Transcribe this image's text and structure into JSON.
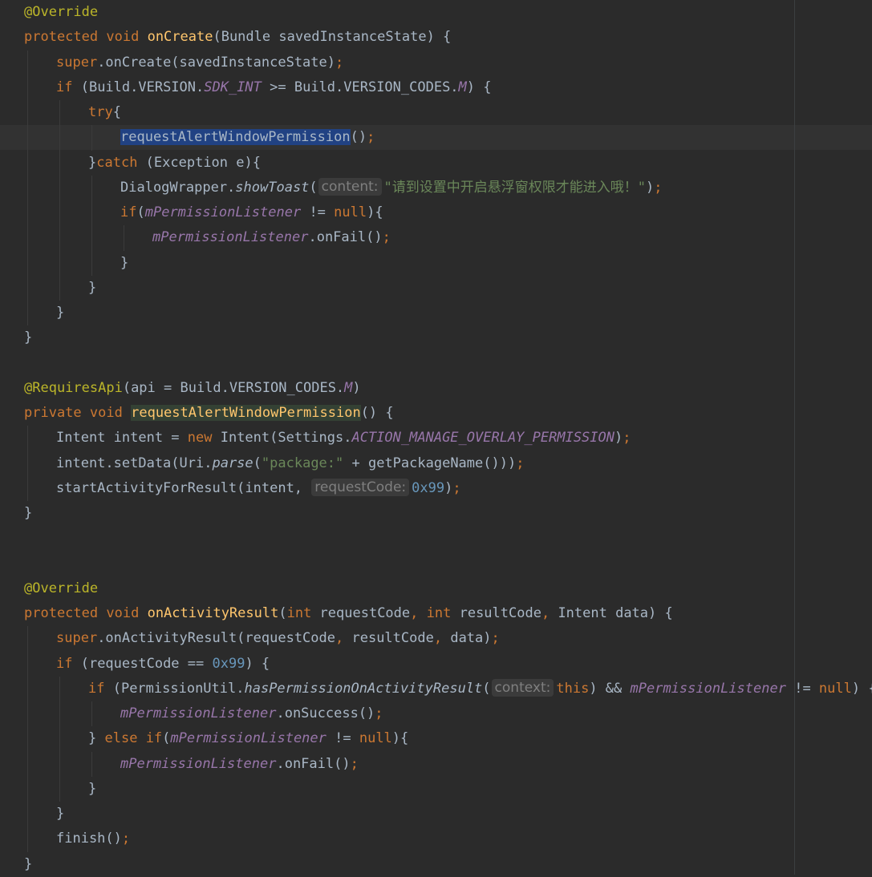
{
  "colors": {
    "background": "#2b2b2b",
    "keyword": "#cc7832",
    "annotation": "#bbb529",
    "method_declaration": "#ffc66d",
    "plain": "#a9b7c6",
    "field": "#9876aa",
    "number": "#6897bb",
    "string": "#6a8759",
    "inlay_hint": "#7f7f7f",
    "selection": "#214283"
  },
  "code": {
    "lines": [
      {
        "indent": 0,
        "tokens": [
          {
            "t": "@Override",
            "k": "ann"
          }
        ]
      },
      {
        "indent": 0,
        "tokens": [
          {
            "t": "protected",
            "k": "kw"
          },
          {
            "t": " "
          },
          {
            "t": "void",
            "k": "kw"
          },
          {
            "t": " "
          },
          {
            "t": "onCreate",
            "k": "fn"
          },
          {
            "t": "(Bundle savedInstanceState) {"
          }
        ]
      },
      {
        "indent": 1,
        "tokens": [
          {
            "t": "super",
            "k": "kw"
          },
          {
            "t": ".onCreate(savedInstanceState)"
          },
          {
            "t": ";",
            "k": "kw"
          }
        ]
      },
      {
        "indent": 1,
        "tokens": [
          {
            "t": "if",
            "k": "kw"
          },
          {
            "t": " (Build.VERSION."
          },
          {
            "t": "SDK_INT",
            "k": "static"
          },
          {
            "t": " >= Build.VERSION_CODES."
          },
          {
            "t": "M",
            "k": "static"
          },
          {
            "t": ") {"
          }
        ]
      },
      {
        "indent": 2,
        "tokens": [
          {
            "t": "try",
            "k": "kw"
          },
          {
            "t": "{"
          }
        ]
      },
      {
        "indent": 3,
        "caret": true,
        "tokens": [
          {
            "t": "requestAlertWindowPermission",
            "k": "sel"
          },
          {
            "t": "()"
          },
          {
            "t": ";",
            "k": "kw"
          }
        ]
      },
      {
        "indent": 2,
        "tokens": [
          {
            "t": "}"
          },
          {
            "t": "catch",
            "k": "kw"
          },
          {
            "t": " (Exception e){"
          }
        ]
      },
      {
        "indent": 3,
        "tokens": [
          {
            "t": "DialogWrapper."
          },
          {
            "t": "showToast",
            "k": "call"
          },
          {
            "t": "("
          },
          {
            "t": "content:",
            "k": "hint"
          },
          {
            "t": "\"请到设置中开启悬浮窗权限才能进入哦！\"",
            "k": "str"
          },
          {
            "t": ")"
          },
          {
            "t": ";",
            "k": "kw"
          }
        ]
      },
      {
        "indent": 3,
        "tokens": [
          {
            "t": "if",
            "k": "kw"
          },
          {
            "t": "("
          },
          {
            "t": "mPermissionListener",
            "k": "field"
          },
          {
            "t": " != "
          },
          {
            "t": "null",
            "k": "kw"
          },
          {
            "t": "){"
          }
        ]
      },
      {
        "indent": 4,
        "tokens": [
          {
            "t": "mPermissionListener",
            "k": "field"
          },
          {
            "t": ".onFail()"
          },
          {
            "t": ";",
            "k": "kw"
          }
        ]
      },
      {
        "indent": 3,
        "tokens": [
          {
            "t": "}"
          }
        ]
      },
      {
        "indent": 2,
        "tokens": [
          {
            "t": "}"
          }
        ]
      },
      {
        "indent": 1,
        "tokens": [
          {
            "t": "}"
          }
        ]
      },
      {
        "indent": 0,
        "tokens": [
          {
            "t": "}"
          }
        ]
      },
      {
        "indent": 0,
        "tokens": []
      },
      {
        "indent": 0,
        "tokens": [
          {
            "t": "@RequiresApi",
            "k": "ann"
          },
          {
            "t": "(api = Build.VERSION_CODES."
          },
          {
            "t": "M",
            "k": "static"
          },
          {
            "t": ")"
          }
        ]
      },
      {
        "indent": 0,
        "tokens": [
          {
            "t": "private",
            "k": "kw"
          },
          {
            "t": " "
          },
          {
            "t": "void",
            "k": "kw"
          },
          {
            "t": " "
          },
          {
            "t": "requestAlertWindowPermission",
            "k": "fnu"
          },
          {
            "t": "() {"
          }
        ]
      },
      {
        "indent": 1,
        "tokens": [
          {
            "t": "Intent intent = "
          },
          {
            "t": "new",
            "k": "kw"
          },
          {
            "t": " Intent(Settings."
          },
          {
            "t": "ACTION_MANAGE_OVERLAY_PERMISSION",
            "k": "static"
          },
          {
            "t": ")"
          },
          {
            "t": ";",
            "k": "kw"
          }
        ]
      },
      {
        "indent": 1,
        "tokens": [
          {
            "t": "intent.setData(Uri."
          },
          {
            "t": "parse",
            "k": "call"
          },
          {
            "t": "("
          },
          {
            "t": "\"package:\"",
            "k": "str"
          },
          {
            "t": " + getPackageName()))"
          },
          {
            "t": ";",
            "k": "kw"
          }
        ]
      },
      {
        "indent": 1,
        "tokens": [
          {
            "t": "startActivityForResult(intent, "
          },
          {
            "t": "requestCode:",
            "k": "hint"
          },
          {
            "t": "0x99",
            "k": "num"
          },
          {
            "t": ")"
          },
          {
            "t": ";",
            "k": "kw"
          }
        ]
      },
      {
        "indent": 0,
        "tokens": [
          {
            "t": "}"
          }
        ]
      },
      {
        "indent": 0,
        "tokens": []
      },
      {
        "indent": 0,
        "tokens": []
      },
      {
        "indent": 0,
        "tokens": [
          {
            "t": "@Override",
            "k": "ann"
          }
        ]
      },
      {
        "indent": 0,
        "tokens": [
          {
            "t": "protected",
            "k": "kw"
          },
          {
            "t": " "
          },
          {
            "t": "void",
            "k": "kw"
          },
          {
            "t": " "
          },
          {
            "t": "onActivityResult",
            "k": "fn"
          },
          {
            "t": "("
          },
          {
            "t": "int",
            "k": "kw"
          },
          {
            "t": " requestCode"
          },
          {
            "t": ",",
            "k": "kw"
          },
          {
            "t": " "
          },
          {
            "t": "int",
            "k": "kw"
          },
          {
            "t": " resultCode"
          },
          {
            "t": ",",
            "k": "kw"
          },
          {
            "t": " Intent data) {"
          }
        ]
      },
      {
        "indent": 1,
        "tokens": [
          {
            "t": "super",
            "k": "kw"
          },
          {
            "t": ".onActivityResult(requestCode"
          },
          {
            "t": ",",
            "k": "kw"
          },
          {
            "t": " resultCode"
          },
          {
            "t": ",",
            "k": "kw"
          },
          {
            "t": " data)"
          },
          {
            "t": ";",
            "k": "kw"
          }
        ]
      },
      {
        "indent": 1,
        "tokens": [
          {
            "t": "if",
            "k": "kw"
          },
          {
            "t": " (requestCode == "
          },
          {
            "t": "0x99",
            "k": "num"
          },
          {
            "t": ") {"
          }
        ]
      },
      {
        "indent": 2,
        "tokens": [
          {
            "t": "if",
            "k": "kw"
          },
          {
            "t": " (PermissionUtil."
          },
          {
            "t": "hasPermissionOnActivityResult",
            "k": "call"
          },
          {
            "t": "("
          },
          {
            "t": "context:",
            "k": "hint"
          },
          {
            "t": "this",
            "k": "kw"
          },
          {
            "t": ") && "
          },
          {
            "t": "mPermissionListener",
            "k": "field"
          },
          {
            "t": " != "
          },
          {
            "t": "null",
            "k": "kw"
          },
          {
            "t": ") {"
          }
        ]
      },
      {
        "indent": 3,
        "tokens": [
          {
            "t": "mPermissionListener",
            "k": "field"
          },
          {
            "t": ".onSuccess()"
          },
          {
            "t": ";",
            "k": "kw"
          }
        ]
      },
      {
        "indent": 2,
        "tokens": [
          {
            "t": "} "
          },
          {
            "t": "else",
            "k": "kw"
          },
          {
            "t": " "
          },
          {
            "t": "if",
            "k": "kw"
          },
          {
            "t": "("
          },
          {
            "t": "mPermissionListener",
            "k": "field"
          },
          {
            "t": " != "
          },
          {
            "t": "null",
            "k": "kw"
          },
          {
            "t": "){"
          }
        ]
      },
      {
        "indent": 3,
        "tokens": [
          {
            "t": "mPermissionListener",
            "k": "field"
          },
          {
            "t": ".onFail()"
          },
          {
            "t": ";",
            "k": "kw"
          }
        ]
      },
      {
        "indent": 2,
        "tokens": [
          {
            "t": "}"
          }
        ]
      },
      {
        "indent": 1,
        "tokens": [
          {
            "t": "}"
          }
        ]
      },
      {
        "indent": 1,
        "tokens": [
          {
            "t": "finish()"
          },
          {
            "t": ";",
            "k": "kw"
          }
        ]
      },
      {
        "indent": 0,
        "tokens": [
          {
            "t": "}"
          }
        ]
      }
    ]
  }
}
